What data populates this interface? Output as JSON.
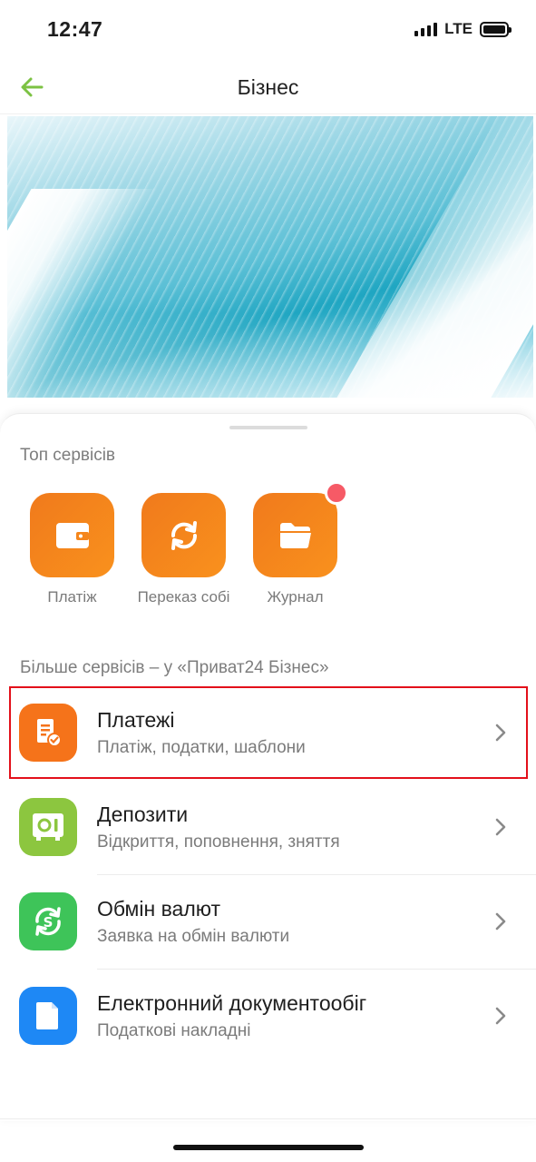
{
  "status_bar": {
    "time": "12:47",
    "network": "LTE",
    "signal_bars": 4,
    "battery_level": 1.0
  },
  "header": {
    "title": "Бізнес",
    "back_icon": "arrow-left-icon",
    "accent_color": "#7cc243"
  },
  "top_services": {
    "section_title": "Топ сервісів",
    "items": [
      {
        "label": "Платіж",
        "icon": "wallet-icon",
        "has_badge": false
      },
      {
        "label": "Переказ собі",
        "icon": "refresh-icon",
        "has_badge": false
      },
      {
        "label": "Журнал",
        "icon": "folder-icon",
        "has_badge": true
      }
    ],
    "tile_color": "#f5861c",
    "badge_color": "#f65a66"
  },
  "more_services": {
    "section_title": "Більше сервісів – у «Приват24 Бізнес»",
    "items": [
      {
        "name": "Платежі",
        "description": "Платіж, податки, шаблони",
        "icon": "payment-doc-icon",
        "color": "#f5731a",
        "highlighted": true
      },
      {
        "name": "Депозити",
        "description": "Відкриття, поповнення, зняття",
        "icon": "safe-icon",
        "color": "#8cc63f",
        "highlighted": false
      },
      {
        "name": "Обмін валют",
        "description": "Заявка на обмін валюти",
        "icon": "currency-exchange-icon",
        "color": "#3ec459",
        "highlighted": false
      },
      {
        "name": "Електронний документообіг",
        "description": "Податкові накладні",
        "icon": "document-icon",
        "color": "#1e88f5",
        "highlighted": false
      }
    ]
  }
}
